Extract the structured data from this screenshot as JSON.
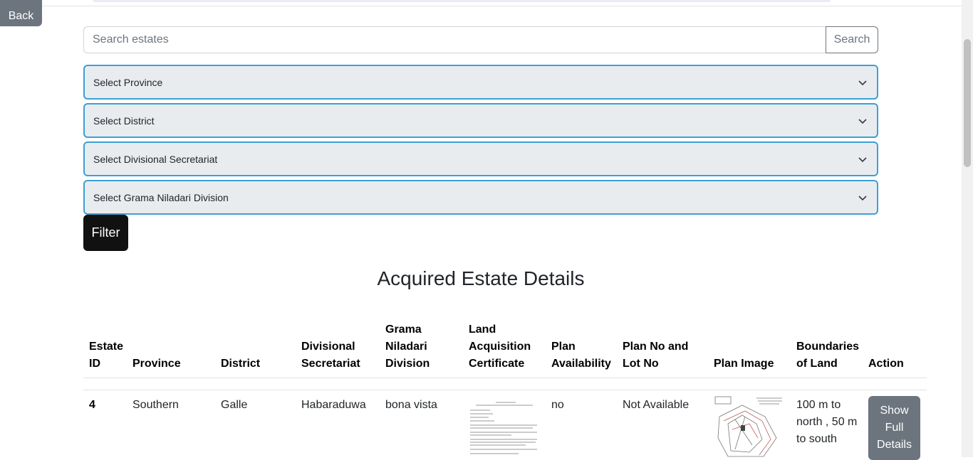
{
  "back_label": "Back",
  "search": {
    "placeholder": "Search estates",
    "button_label": "Search"
  },
  "filters": {
    "province_placeholder": "Select Province",
    "district_placeholder": "Select District",
    "divisional_placeholder": "Select Divisional Secretariat",
    "grama_placeholder": "Select Grama Niladari Division",
    "filter_label": "Filter"
  },
  "page_title": "Acquired Estate Details",
  "table": {
    "headers": {
      "estate_id": "Estate ID",
      "province": "Province",
      "district": "District",
      "divisional": "Divisional Secretariat",
      "grama": "Grama Niladari Division",
      "certificate": "Land Acquisition Certificate",
      "plan_availability": "Plan Availability",
      "plan_no": "Plan No and Lot No",
      "plan_image": "Plan Image",
      "boundaries": "Boundaries of Land",
      "action": "Action"
    },
    "rows": [
      {
        "estate_id": "4",
        "province": "Southern",
        "district": "Galle",
        "divisional": "Habaraduwa",
        "grama": "bona vista",
        "plan_availability": "no",
        "plan_no": "Not Available",
        "boundaries": "100 m to north , 50 m to south",
        "action_label": "Show Full Details"
      }
    ]
  },
  "colors": {
    "select_border": "#3d9fd6",
    "select_bg": "#e9ecef",
    "filter_bg": "#111111",
    "secondary": "#6c757d"
  }
}
